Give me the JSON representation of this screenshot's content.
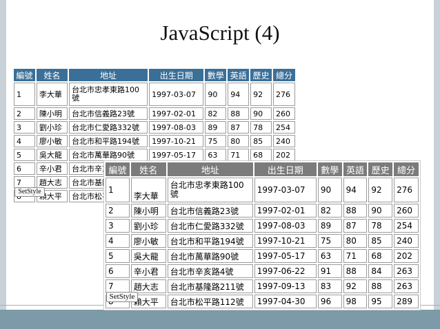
{
  "slide": {
    "title": "JavaScript (4)"
  },
  "headers": [
    "編號",
    "姓名",
    "地址",
    "出生日期",
    "數學",
    "英語",
    "歷史",
    "總分"
  ],
  "rows": [
    [
      "1",
      "李大華",
      "台北市忠孝東路100號",
      "1997-03-07",
      "90",
      "94",
      "92",
      "276"
    ],
    [
      "2",
      "陳小明",
      "台北市信義路23號",
      "1997-02-01",
      "82",
      "88",
      "90",
      "260"
    ],
    [
      "3",
      "劉小珍",
      "台北市仁愛路332號",
      "1997-08-03",
      "89",
      "87",
      "78",
      "254"
    ],
    [
      "4",
      "廖小敏",
      "台北市和平路194號",
      "1997-10-21",
      "75",
      "80",
      "85",
      "240"
    ],
    [
      "5",
      "吳大龍",
      "台北市萬華路90號",
      "1997-05-17",
      "63",
      "71",
      "68",
      "202"
    ],
    [
      "6",
      "辛小君",
      "台北市辛亥路4號",
      "1997-06-22",
      "91",
      "88",
      "84",
      "263"
    ],
    [
      "7",
      "趙大志",
      "台北市基隆路211號",
      "1997-09-13",
      "83",
      "92",
      "88",
      "263"
    ],
    [
      "8",
      "賴大平",
      "台北市松平路112號",
      "1997-04-30",
      "96",
      "98",
      "95",
      "289"
    ]
  ],
  "buttons": {
    "setstyle_label": "SetStyle"
  },
  "colors": {
    "header_blue": "#3a6f98",
    "header_gray": "#7b7b7b",
    "footer_bar": "#7c9aa8"
  }
}
